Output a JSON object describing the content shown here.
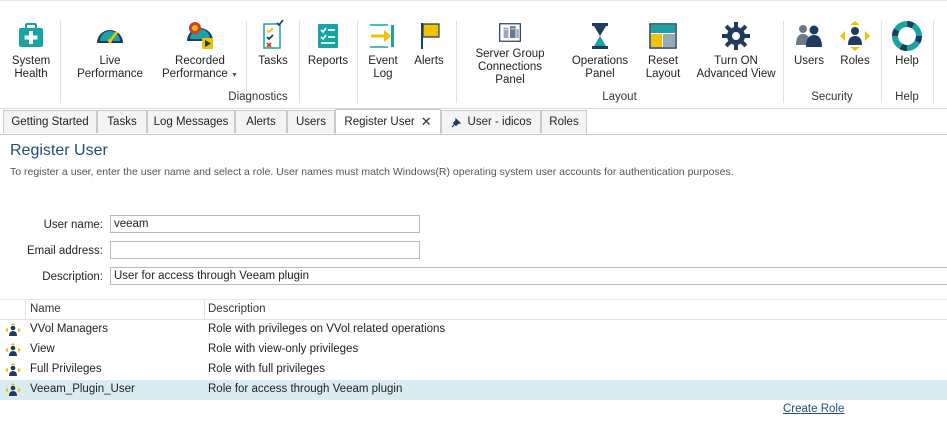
{
  "ribbon": {
    "buttons": [
      {
        "label": "System\nHealth",
        "icon": "system-health-icon"
      },
      {
        "label": "Live Performance",
        "icon": "speedometer-icon"
      },
      {
        "label": "Recorded\nPerformance",
        "icon": "recorded-performance-icon"
      },
      {
        "label": "Tasks",
        "icon": "tasks-icon"
      },
      {
        "label": "Reports",
        "icon": "reports-icon"
      },
      {
        "label": "Event\nLog",
        "icon": "event-log-icon"
      },
      {
        "label": "Alerts",
        "icon": "flag-icon"
      },
      {
        "label": "Server Group\nConnections Panel",
        "icon": "server-group-icon"
      },
      {
        "label": "Operations\nPanel",
        "icon": "hourglass-icon"
      },
      {
        "label": "Reset\nLayout",
        "icon": "reset-layout-icon"
      },
      {
        "label": "Turn ON\nAdvanced View",
        "icon": "gear-icon"
      },
      {
        "label": "Users",
        "icon": "users-icon"
      },
      {
        "label": "Roles",
        "icon": "roles-icon"
      },
      {
        "label": "Help",
        "icon": "lifebuoy-icon"
      }
    ],
    "groups": {
      "diagnostics": "Diagnostics",
      "layout": "Layout",
      "security": "Security",
      "help": "Help"
    },
    "colors": {
      "teal": "#1aa3a3",
      "navy": "#1f3a5f",
      "yellow": "#f2c200",
      "red": "#d93a2b"
    }
  },
  "tabs": [
    {
      "label": "Getting Started"
    },
    {
      "label": "Tasks"
    },
    {
      "label": "Log Messages"
    },
    {
      "label": "Alerts"
    },
    {
      "label": "Users"
    },
    {
      "label": "Register User",
      "active": true
    },
    {
      "label": "User - idicos",
      "pinned": true
    },
    {
      "label": "Roles"
    }
  ],
  "tab_close_glyph": "✕",
  "page": {
    "title": "Register User",
    "description": "To register a user, enter the user name and select a role. User names must match Windows(R) operating system user accounts for authentication purposes."
  },
  "form": {
    "user_name_label": "User name:",
    "user_name_value": "veeam",
    "email_label": "Email address:",
    "email_value": "",
    "description_label": "Description:",
    "description_value": "User for access through Veeam plugin"
  },
  "roles_list": {
    "columns": {
      "name": "Name",
      "description": "Description"
    },
    "rows": [
      {
        "name": "VVol Managers",
        "description": "Role with privileges on VVol related operations"
      },
      {
        "name": "View",
        "description": "Role with view-only privileges"
      },
      {
        "name": "Full Privileges",
        "description": "Role with full privileges"
      },
      {
        "name": "Veeam_Plugin_User",
        "description": "Role for access through Veeam plugin",
        "selected": true
      }
    ],
    "selected_row_color": "#d9ecf2"
  },
  "create_role_link": "Create Role"
}
